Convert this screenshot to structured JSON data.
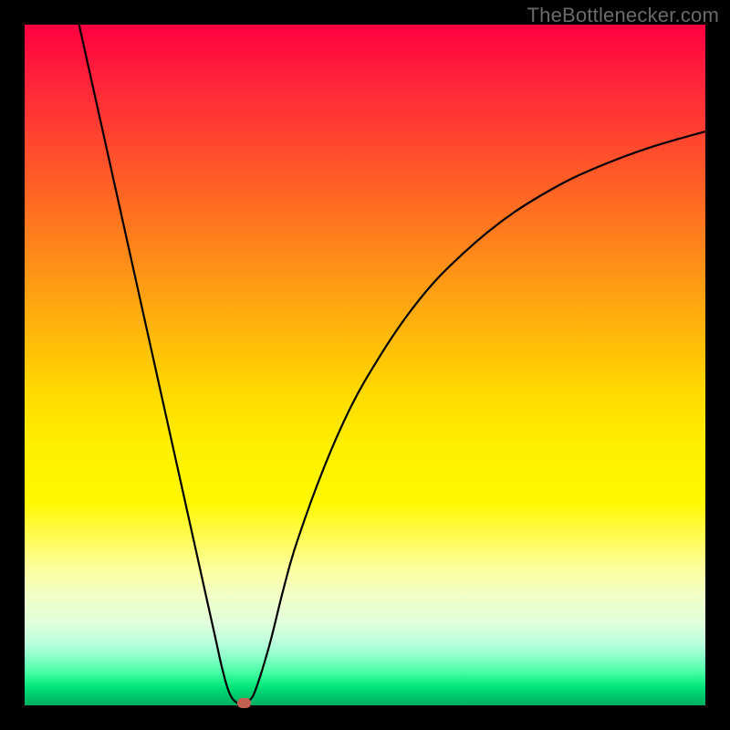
{
  "watermark": "TheBottlenecker.com",
  "chart_data": {
    "type": "line",
    "title": "",
    "xlabel": "",
    "ylabel": "",
    "xlim": [
      0,
      100
    ],
    "ylim": [
      0,
      100
    ],
    "series": [
      {
        "name": "bottleneck-curve",
        "x": [
          8,
          10,
          12,
          14,
          16,
          18,
          20,
          22,
          24,
          26,
          28,
          29,
          30,
          31,
          32,
          33,
          34,
          36,
          38,
          40,
          44,
          48,
          52,
          56,
          60,
          64,
          68,
          72,
          76,
          80,
          84,
          88,
          92,
          96,
          100
        ],
        "values": [
          100,
          91,
          82,
          73,
          64,
          55,
          46,
          37,
          28,
          19,
          10,
          5.5,
          2,
          0.5,
          0.3,
          0.7,
          2.5,
          9,
          17,
          24,
          35,
          44,
          51,
          57,
          62,
          66,
          69.5,
          72.5,
          75,
          77.2,
          79,
          80.6,
          82,
          83.2,
          84.3
        ]
      }
    ],
    "marker": {
      "x": 32.2,
      "y": 0.3,
      "color": "#c06050"
    },
    "grid": false,
    "legend": false
  }
}
